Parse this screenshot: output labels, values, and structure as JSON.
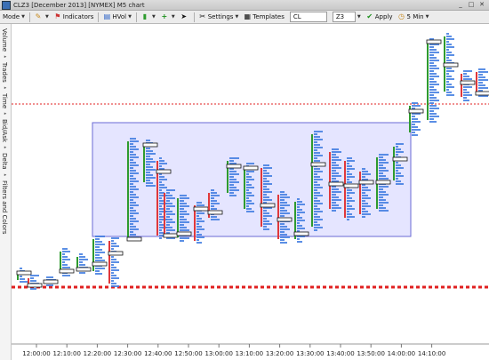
{
  "window": {
    "title": "CLZ3 [December 2013] [NYMEX] M5 chart"
  },
  "toolbar": {
    "mode_label": "Mode",
    "indicators_label": "Indicators",
    "hvol_label": "HVol",
    "settings_label": "Settings",
    "templates_label": "Templates",
    "symbol_value": "CL",
    "preset_value": "Z3",
    "apply_label": "Apply",
    "timeframe_label": "5 Min"
  },
  "sidebar": {
    "items": [
      "Volume",
      "Trades",
      "Time",
      "Bid/Ask",
      "Delta",
      "Filters and Colors"
    ]
  },
  "chart": {
    "x_labels": [
      "12:00:00",
      "12:10:00",
      "12:20:00",
      "12:30:00",
      "12:40:00",
      "12:50:00",
      "13:00:00",
      "13:10:00",
      "13:20:00",
      "13:30:00",
      "13:40:00",
      "13:50:00",
      "14:00:00",
      "14:10:00"
    ],
    "colors": {
      "up": "#2e9b2e",
      "down": "#e0383b",
      "profile": "#3e7be0",
      "zone_fill": "#dcdcff",
      "zone_border": "#6a6ad4",
      "level": "#e02020"
    }
  }
}
